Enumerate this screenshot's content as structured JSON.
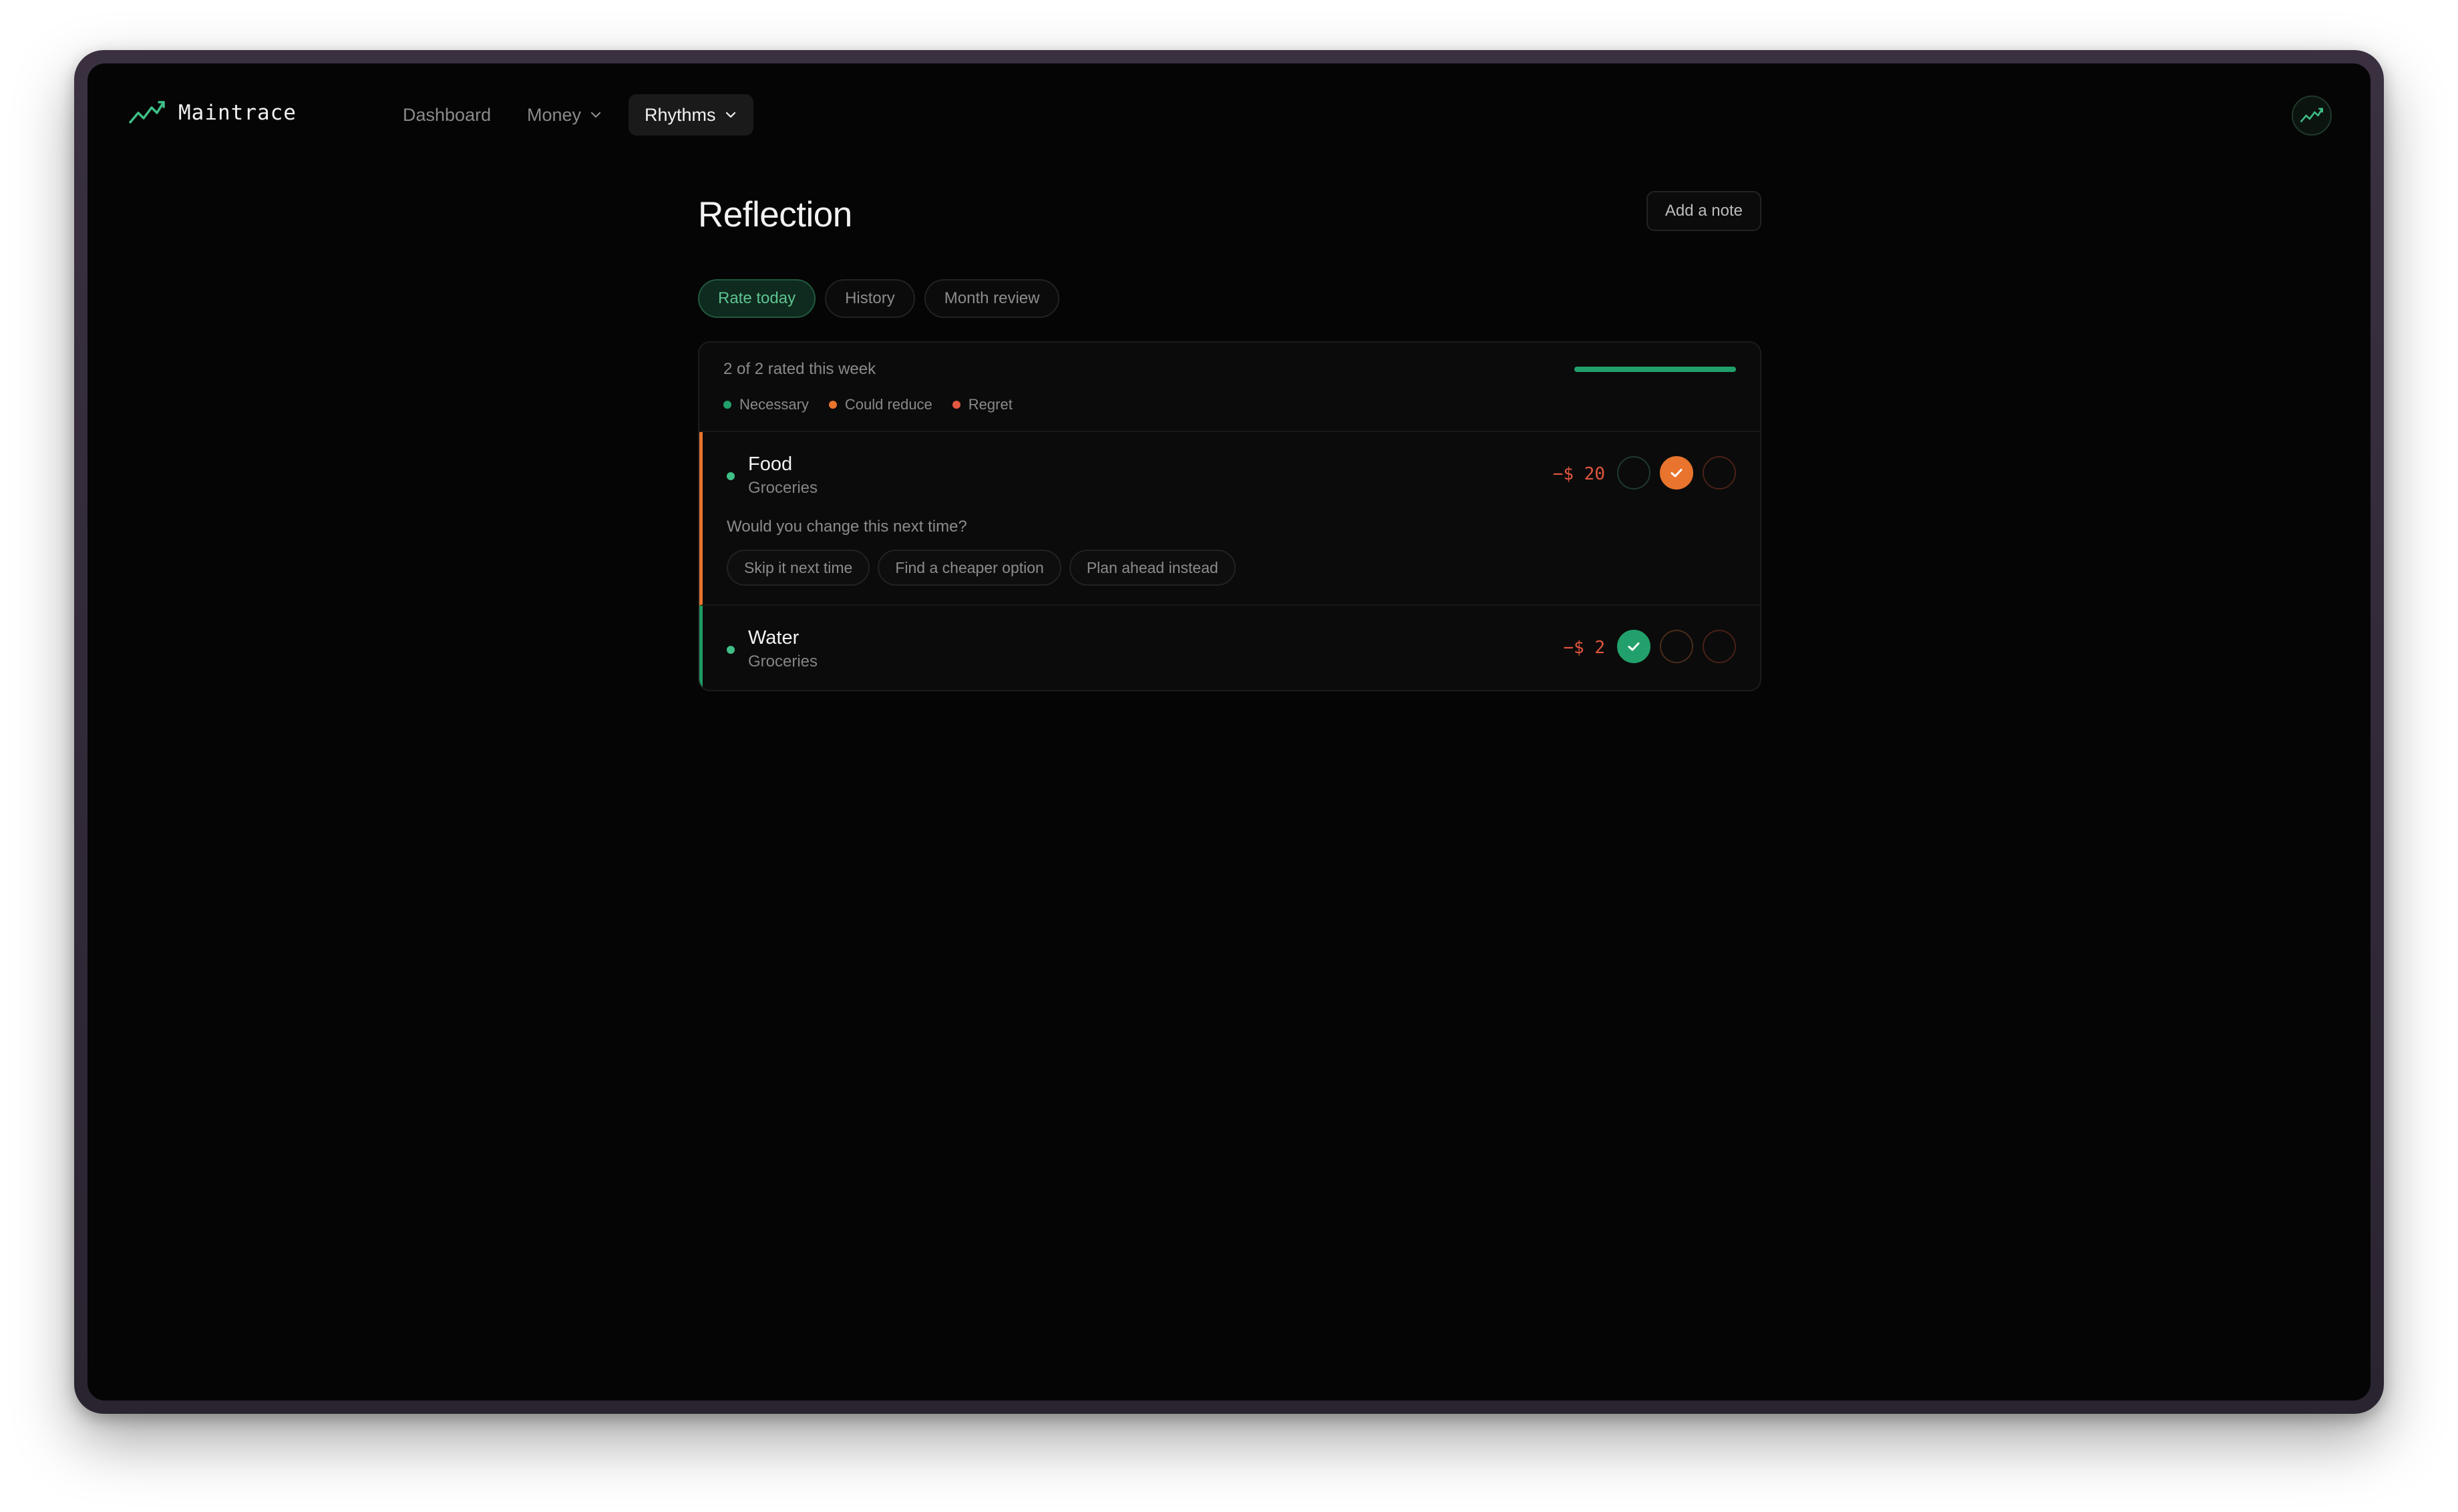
{
  "app": {
    "name": "Maintrace"
  },
  "nav": {
    "items": [
      {
        "label": "Dashboard",
        "active": false,
        "dropdown": false
      },
      {
        "label": "Money",
        "active": false,
        "dropdown": true
      },
      {
        "label": "Rhythms",
        "active": true,
        "dropdown": true
      }
    ]
  },
  "page": {
    "title": "Reflection",
    "add_note_label": "Add a note",
    "tabs": [
      {
        "label": "Rate today",
        "active": true
      },
      {
        "label": "History",
        "active": false
      },
      {
        "label": "Month review",
        "active": false
      }
    ]
  },
  "summary": {
    "text": "2 of 2 rated this week",
    "rated": 2,
    "total": 2,
    "progress_fraction": 1.0
  },
  "legend": [
    {
      "label": "Necessary",
      "color": "#22a06b"
    },
    {
      "label": "Could reduce",
      "color": "#e8742d"
    },
    {
      "label": "Regret",
      "color": "#e2573f"
    }
  ],
  "entries": [
    {
      "name": "Food",
      "category": "Groceries",
      "amount": "−$ 20",
      "rating": "could-reduce",
      "accent": "#e8742d",
      "question": "Would you change this next time?",
      "options": [
        "Skip it next time",
        "Find a cheaper option",
        "Plan ahead instead"
      ]
    },
    {
      "name": "Water",
      "category": "Groceries",
      "amount": "−$ 2",
      "rating": "necessary",
      "accent": "#1f9a63"
    }
  ],
  "icons": {
    "brand": "trend-line-icon",
    "dropdown": "chevron-down-icon",
    "rating_selected": "check-icon",
    "avatar": "trend-line-icon"
  }
}
